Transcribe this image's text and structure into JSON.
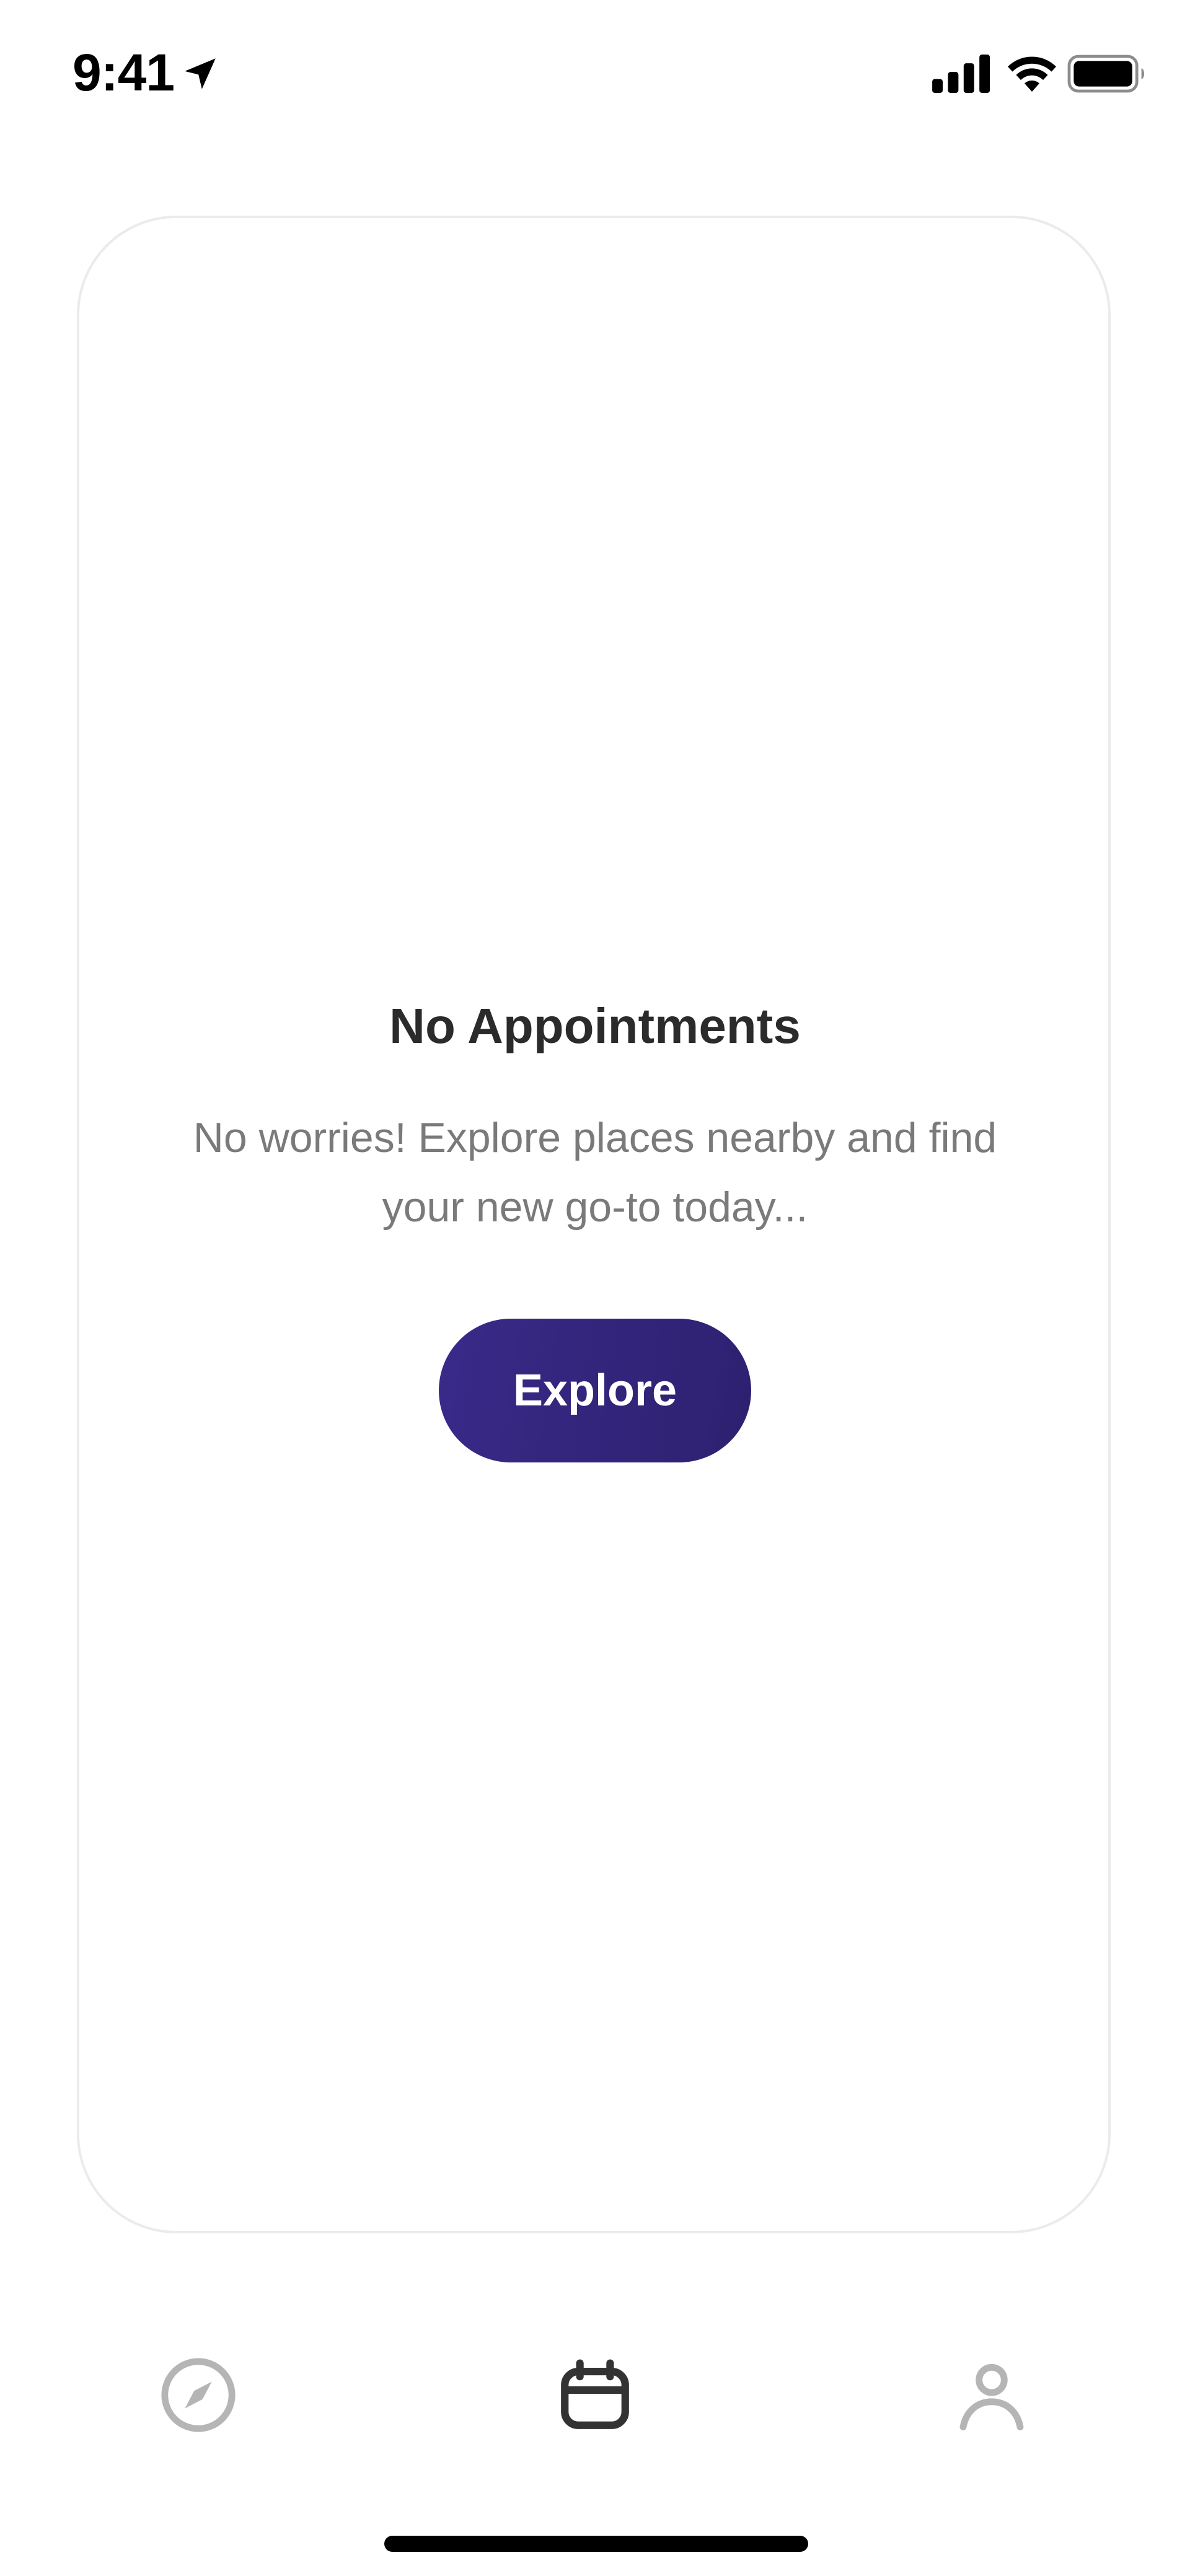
{
  "status_bar": {
    "time": "9:41",
    "icons": [
      "location-arrow-icon",
      "cellular-signal-icon",
      "wifi-icon",
      "battery-icon"
    ]
  },
  "empty_state": {
    "title": "No Appointments",
    "message": "No worries! Explore places nearby and find your new go-to today...",
    "button_label": "Explore"
  },
  "tab_bar": {
    "tabs": [
      {
        "icon": "compass-icon",
        "active": false
      },
      {
        "icon": "calendar-icon",
        "active": true
      },
      {
        "icon": "user-icon",
        "active": false
      }
    ]
  },
  "colors": {
    "accent": "#34267e",
    "title_text": "#2b2b2b",
    "body_text": "#7a7a7a",
    "inactive_icon": "#b5b5b5",
    "active_icon": "#333333",
    "card_border": "#ebebeb"
  }
}
